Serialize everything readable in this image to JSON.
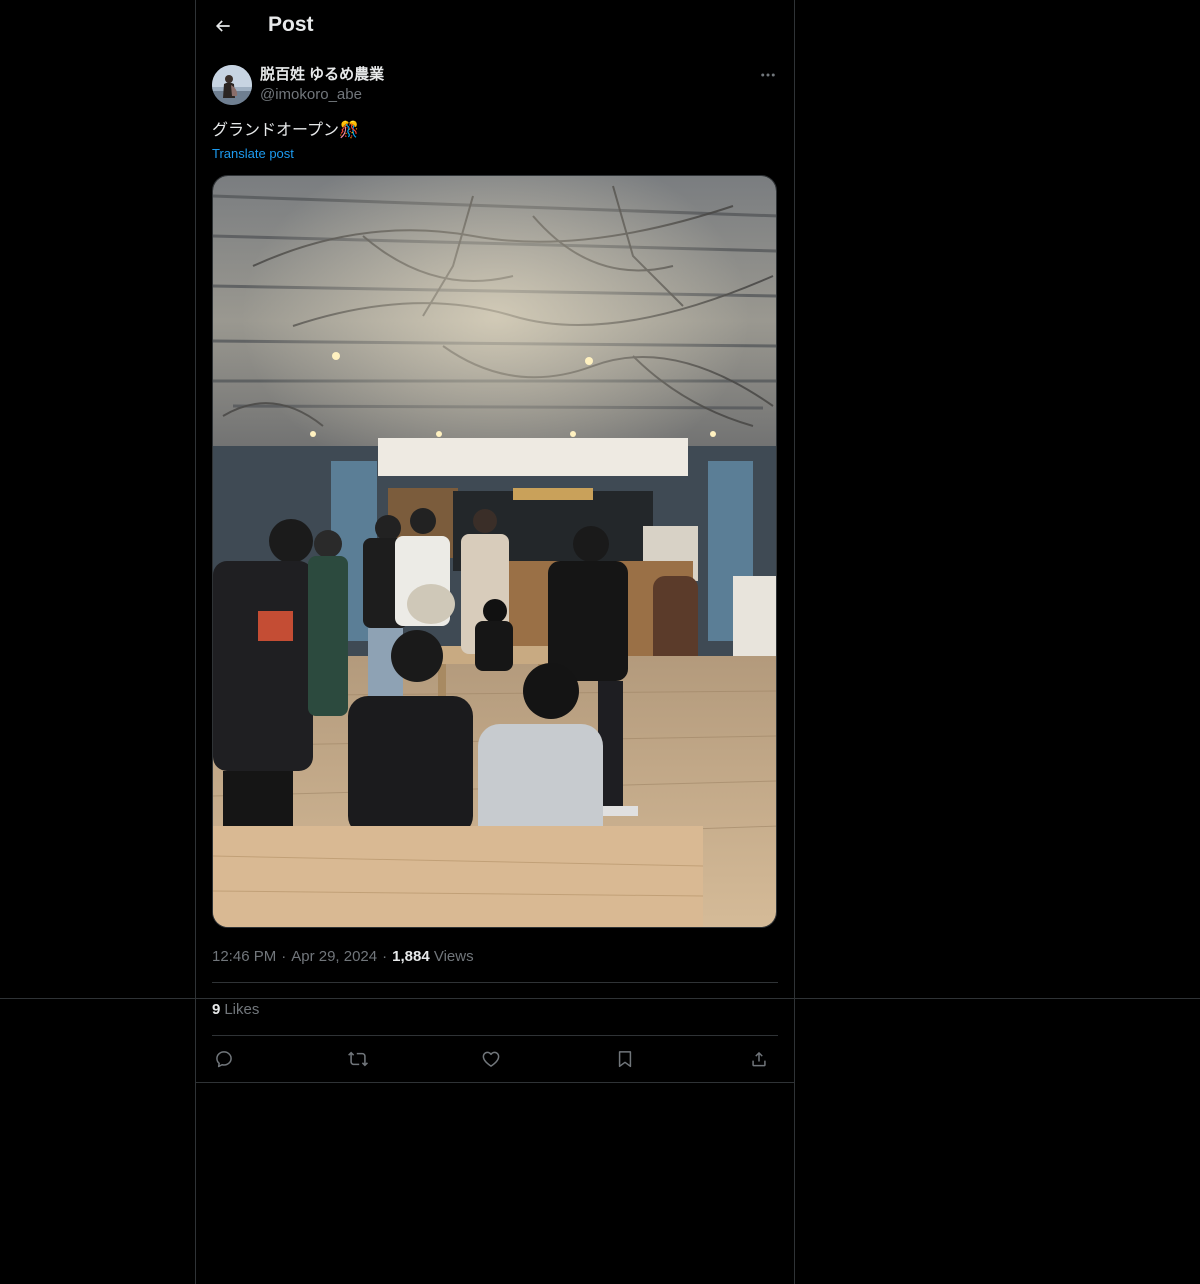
{
  "header": {
    "title": "Post",
    "back_icon": "arrow-left-icon"
  },
  "post": {
    "author": {
      "display_name": "脱百姓 ゆるめ農業",
      "handle": "@imokoro_abe"
    },
    "text": "グランドオープン🎊",
    "translate_label": "Translate post",
    "media_alt": "Image",
    "time": "12:46 PM",
    "date": "Apr 29, 2024",
    "views_count": "1,884",
    "views_label": "Views",
    "likes_count": "9",
    "likes_label": "Likes"
  },
  "actions": [
    {
      "name": "reply",
      "icon": "reply-icon"
    },
    {
      "name": "repost",
      "icon": "repost-icon"
    },
    {
      "name": "like",
      "icon": "heart-icon"
    },
    {
      "name": "bookmark",
      "icon": "bookmark-icon"
    },
    {
      "name": "share",
      "icon": "share-icon"
    }
  ],
  "colors": {
    "background": "#000000",
    "text_primary": "#e7e9ea",
    "text_secondary": "#71767b",
    "accent": "#1d9bf0",
    "border": "#2f3336"
  }
}
